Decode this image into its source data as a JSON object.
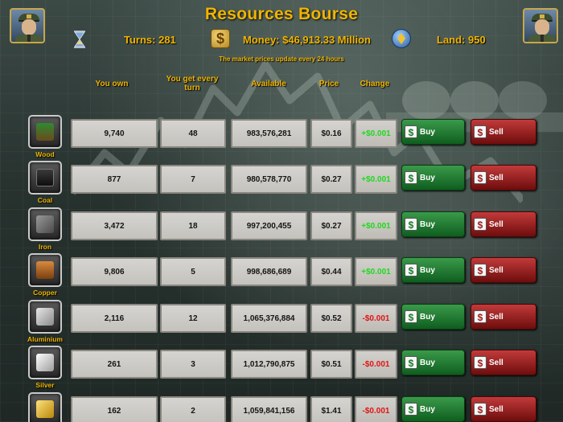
{
  "header": {
    "title": "Resources Bourse",
    "turns_label": "Turns: 281",
    "money_label": "Money: $46,913.33 Million",
    "land_label": "Land: 950",
    "notice": "The market prices update every 24 hours"
  },
  "columns": {
    "own": "You own",
    "per_turn": "You get every turn",
    "available": "Available",
    "price": "Price",
    "change": "Change"
  },
  "buttons": {
    "buy": "Buy",
    "sell": "Sell",
    "money_glyph": "$"
  },
  "colors": {
    "accent": "#f0b400",
    "buy": "#1f7a30",
    "sell": "#9a1a1a",
    "change_up": "#1fd81f",
    "change_down": "#e01414"
  },
  "resources": [
    {
      "name": "Wood",
      "icon": "wood-icon",
      "own": "9,740",
      "per_turn": "48",
      "available": "983,576,281",
      "price": "$0.16",
      "change": "+$0.001",
      "direction": "up"
    },
    {
      "name": "Coal",
      "icon": "coal-icon",
      "own": "877",
      "per_turn": "7",
      "available": "980,578,770",
      "price": "$0.27",
      "change": "+$0.001",
      "direction": "up"
    },
    {
      "name": "Iron",
      "icon": "iron-icon",
      "own": "3,472",
      "per_turn": "18",
      "available": "997,200,455",
      "price": "$0.27",
      "change": "+$0.001",
      "direction": "up"
    },
    {
      "name": "Copper",
      "icon": "copper-icon",
      "own": "9,806",
      "per_turn": "5",
      "available": "998,686,689",
      "price": "$0.44",
      "change": "+$0.001",
      "direction": "up"
    },
    {
      "name": "Aluminium",
      "icon": "aluminium-icon",
      "own": "2,116",
      "per_turn": "12",
      "available": "1,065,376,884",
      "price": "$0.52",
      "change": "-$0.001",
      "direction": "down"
    },
    {
      "name": "Silver",
      "icon": "silver-icon",
      "own": "261",
      "per_turn": "3",
      "available": "1,012,790,875",
      "price": "$0.51",
      "change": "-$0.001",
      "direction": "down"
    },
    {
      "name": "Gold",
      "icon": "gold-icon",
      "own": "162",
      "per_turn": "2",
      "available": "1,059,841,156",
      "price": "$1.41",
      "change": "-$0.001",
      "direction": "down"
    }
  ]
}
